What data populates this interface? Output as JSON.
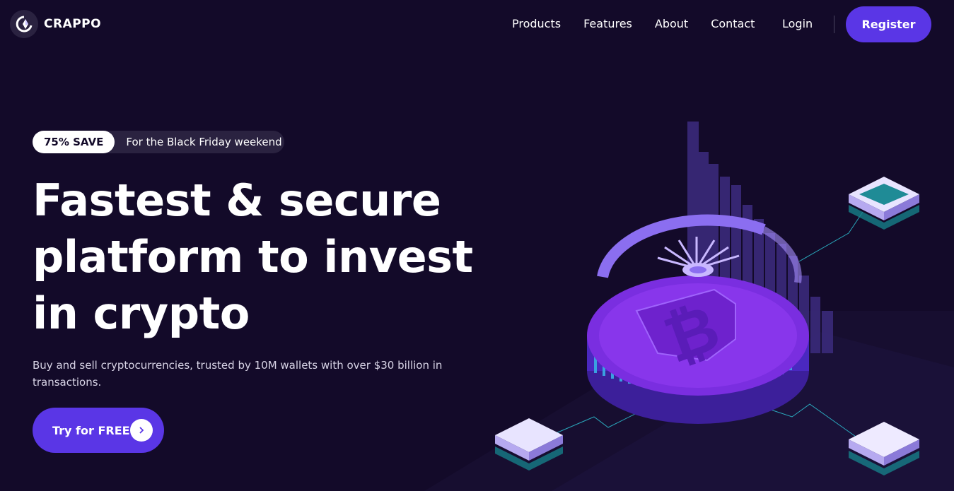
{
  "nav": {
    "logo_text": "CRAPPO",
    "links": [
      "Products",
      "Features",
      "About",
      "Contact"
    ],
    "login": "Login",
    "register": "Register"
  },
  "hero": {
    "badge_pill": "75% SAVE",
    "badge_text": "For the Black Friday weekend",
    "headline_lines": [
      "Fastest & secure",
      "platform to invest",
      "in crypto"
    ],
    "subtext": "Buy and sell cryptocurrencies, trusted by 10M wallets with over $30 billion in transactions.",
    "cta_label": "Try for FREE"
  },
  "colors": {
    "background": "#130a29",
    "accent": "#5a36e6",
    "pill_bg": "#2a2240"
  },
  "icons": {
    "logo": "crappo-logo-icon",
    "cta_arrow": "chevron-right-icon",
    "illustration": "bitcoin-coin-illustration"
  }
}
